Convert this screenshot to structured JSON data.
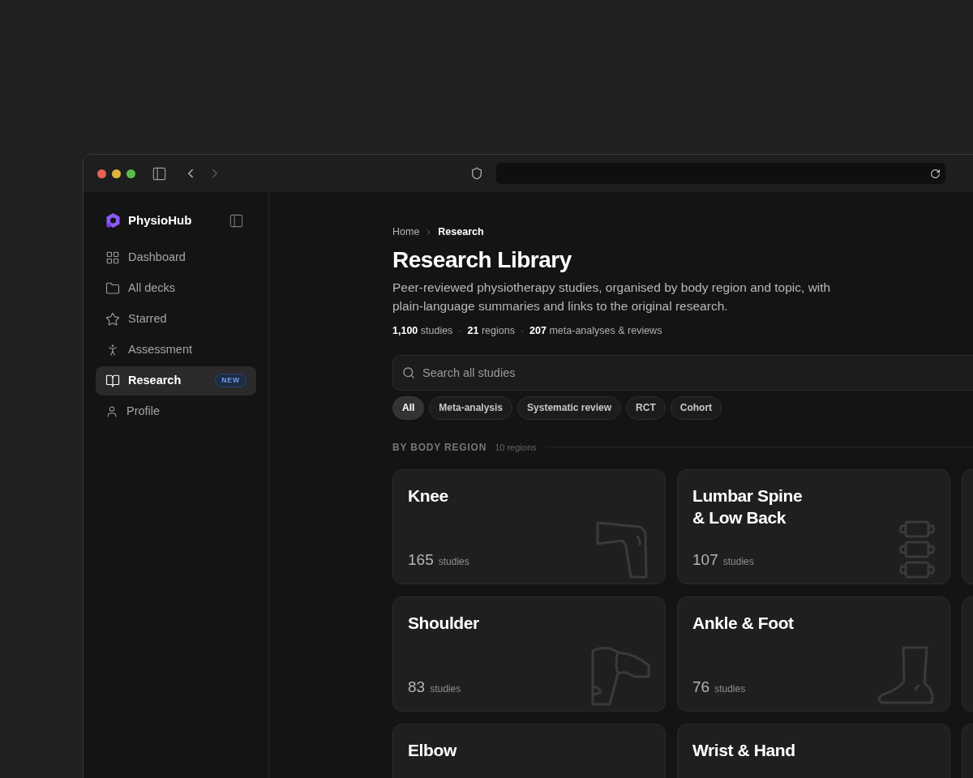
{
  "sidebar": {
    "brand": "PhysioHub",
    "items": [
      {
        "label": "Dashboard",
        "kind": "grid",
        "selected": false
      },
      {
        "label": "All decks",
        "kind": "folder",
        "selected": false
      },
      {
        "label": "Starred",
        "kind": "star",
        "selected": false
      },
      {
        "label": "Assessment",
        "kind": "person",
        "selected": false
      },
      {
        "label": "Research",
        "kind": "book",
        "selected": true,
        "badge": "NEW"
      },
      {
        "label": "Profile",
        "kind": "user",
        "selected": false
      }
    ]
  },
  "breadcrumb": [
    "Home",
    "Research"
  ],
  "title": "Research Library",
  "description": "Peer-reviewed physiotherapy studies, organised by body region and topic, with plain-language summaries and links to the original research.",
  "stats": {
    "separator": "·",
    "items": [
      "**1,100** studies",
      "**21** regions",
      "**207** meta-analyses & reviews"
    ]
  },
  "search": {
    "placeholder": "Search all studies"
  },
  "filters": [
    {
      "label": "All",
      "selected": true
    },
    {
      "label": "Meta-analysis",
      "selected": false
    },
    {
      "label": "Systematic review",
      "selected": false
    },
    {
      "label": "RCT",
      "selected": false
    },
    {
      "label": "Cohort",
      "selected": false
    }
  ],
  "section": {
    "title": "BY BODY REGION",
    "count": "10 regions"
  },
  "regions": [
    {
      "name": "Knee",
      "count": "165",
      "unit": "studies",
      "kind": "knee"
    },
    {
      "name": "Lumbar Spine\n& Low Back",
      "count": "107",
      "unit": "studies",
      "kind": "spine"
    },
    {
      "name": "Shoulder",
      "count": "83",
      "unit": "studies",
      "kind": "shoulder"
    },
    {
      "name": "Ankle & Foot",
      "count": "76",
      "unit": "studies",
      "kind": "foot"
    },
    {
      "name": "Elbow",
      "kind": "none"
    },
    {
      "name": "Wrist & Hand",
      "kind": "none"
    }
  ]
}
